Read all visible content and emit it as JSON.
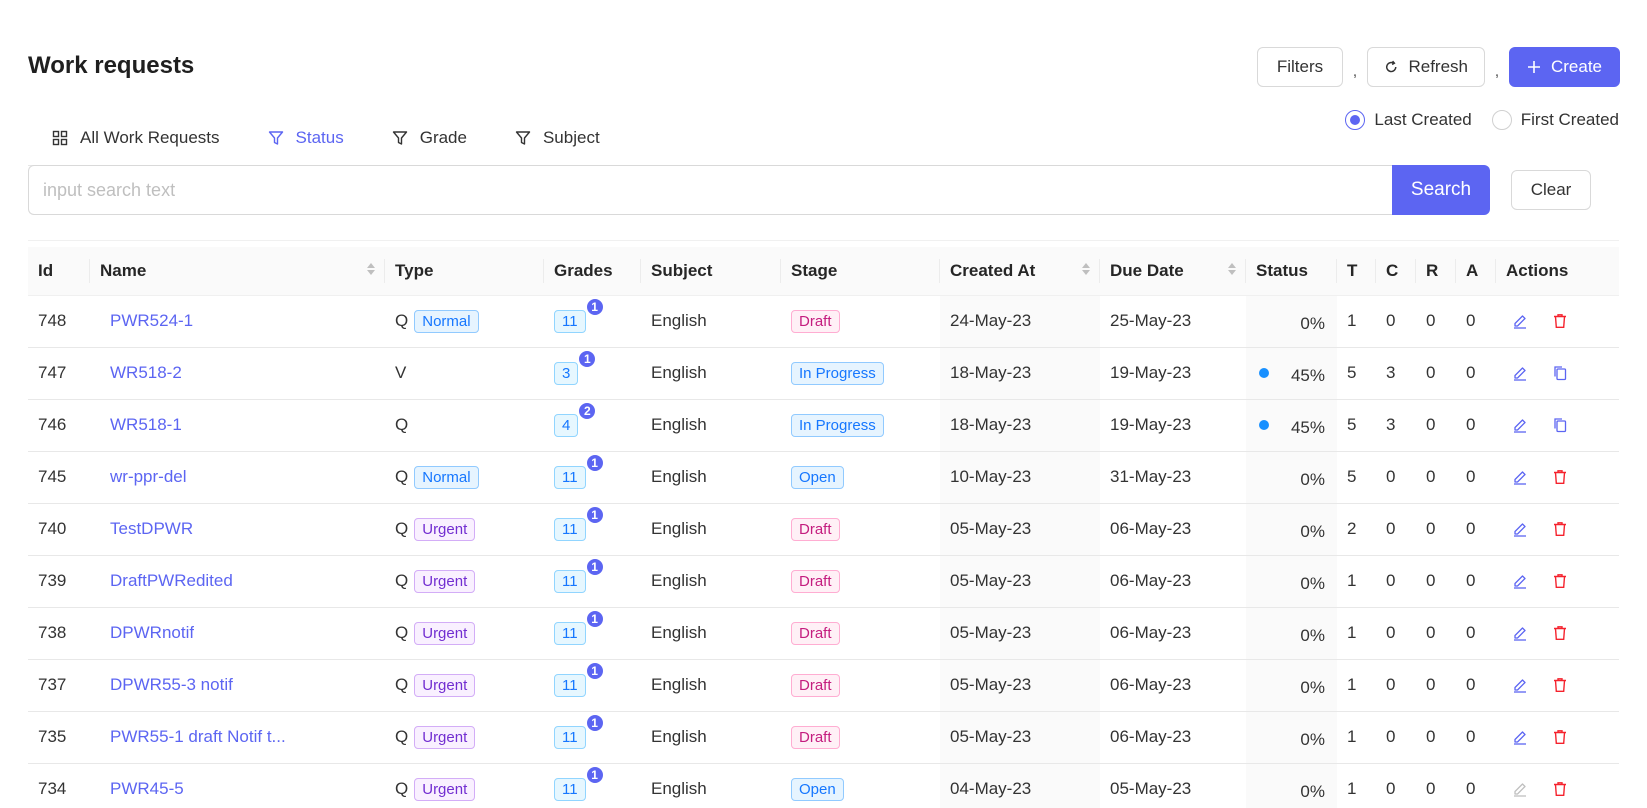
{
  "page": {
    "title": "Work requests"
  },
  "toolbar": {
    "filters_label": "Filters",
    "separator": ",",
    "refresh_label": "Refresh",
    "create_label": "Create"
  },
  "sort_options": [
    {
      "label": "Last Created",
      "selected": true
    },
    {
      "label": "First Created",
      "selected": false
    }
  ],
  "tabs": [
    {
      "label": "All Work Requests",
      "icon": "grid-icon",
      "active": false
    },
    {
      "label": "Status",
      "icon": "filter-icon",
      "active": true
    },
    {
      "label": "Grade",
      "icon": "filter-icon",
      "active": false
    },
    {
      "label": "Subject",
      "icon": "filter-icon",
      "active": false
    }
  ],
  "search": {
    "placeholder": "input search text",
    "value": "",
    "button_label": "Search",
    "clear_label": "Clear"
  },
  "table": {
    "columns": [
      "Id",
      "Name",
      "Type",
      "Grades",
      "Subject",
      "Stage",
      "Created At",
      "Due Date",
      "Status",
      "T",
      "C",
      "R",
      "A",
      "Actions"
    ],
    "rows": [
      {
        "id": "748",
        "name": "PWR524-1",
        "type": "Q",
        "priority": "Normal",
        "grade": "11",
        "grade_count": "1",
        "subject": "English",
        "stage": "Draft",
        "created": "24-May-23",
        "due": "25-May-23",
        "status": "0%",
        "status_dot": false,
        "t": "1",
        "c": "0",
        "r": "0",
        "a": "0",
        "second_action": "delete"
      },
      {
        "id": "747",
        "name": "WR518-2",
        "type": "V",
        "priority": "",
        "grade": "3",
        "grade_count": "1",
        "subject": "English",
        "stage": "In Progress",
        "created": "18-May-23",
        "due": "19-May-23",
        "status": "45%",
        "status_dot": true,
        "t": "5",
        "c": "3",
        "r": "0",
        "a": "0",
        "second_action": "copy"
      },
      {
        "id": "746",
        "name": "WR518-1",
        "type": "Q",
        "priority": "",
        "grade": "4",
        "grade_count": "2",
        "subject": "English",
        "stage": "In Progress",
        "created": "18-May-23",
        "due": "19-May-23",
        "status": "45%",
        "status_dot": true,
        "t": "5",
        "c": "3",
        "r": "0",
        "a": "0",
        "second_action": "copy"
      },
      {
        "id": "745",
        "name": "wr-ppr-del",
        "type": "Q",
        "priority": "Normal",
        "grade": "11",
        "grade_count": "1",
        "subject": "English",
        "stage": "Open",
        "created": "10-May-23",
        "due": "31-May-23",
        "status": "0%",
        "status_dot": false,
        "t": "5",
        "c": "0",
        "r": "0",
        "a": "0",
        "second_action": "delete"
      },
      {
        "id": "740",
        "name": "TestDPWR",
        "type": "Q",
        "priority": "Urgent",
        "grade": "11",
        "grade_count": "1",
        "subject": "English",
        "stage": "Draft",
        "created": "05-May-23",
        "due": "06-May-23",
        "status": "0%",
        "status_dot": false,
        "t": "2",
        "c": "0",
        "r": "0",
        "a": "0",
        "second_action": "delete"
      },
      {
        "id": "739",
        "name": "DraftPWRedited",
        "type": "Q",
        "priority": "Urgent",
        "grade": "11",
        "grade_count": "1",
        "subject": "English",
        "stage": "Draft",
        "created": "05-May-23",
        "due": "06-May-23",
        "status": "0%",
        "status_dot": false,
        "t": "1",
        "c": "0",
        "r": "0",
        "a": "0",
        "second_action": "delete"
      },
      {
        "id": "738",
        "name": "DPWRnotif",
        "type": "Q",
        "priority": "Urgent",
        "grade": "11",
        "grade_count": "1",
        "subject": "English",
        "stage": "Draft",
        "created": "05-May-23",
        "due": "06-May-23",
        "status": "0%",
        "status_dot": false,
        "t": "1",
        "c": "0",
        "r": "0",
        "a": "0",
        "second_action": "delete"
      },
      {
        "id": "737",
        "name": "DPWR55-3 notif",
        "type": "Q",
        "priority": "Urgent",
        "grade": "11",
        "grade_count": "1",
        "subject": "English",
        "stage": "Draft",
        "created": "05-May-23",
        "due": "06-May-23",
        "status": "0%",
        "status_dot": false,
        "t": "1",
        "c": "0",
        "r": "0",
        "a": "0",
        "second_action": "delete"
      },
      {
        "id": "735",
        "name": "PWR55-1 draft Notif t...",
        "type": "Q",
        "priority": "Urgent",
        "grade": "11",
        "grade_count": "1",
        "subject": "English",
        "stage": "Draft",
        "created": "05-May-23",
        "due": "06-May-23",
        "status": "0%",
        "status_dot": false,
        "t": "1",
        "c": "0",
        "r": "0",
        "a": "0",
        "second_action": "delete"
      },
      {
        "id": "734",
        "name": "PWR45-5",
        "type": "Q",
        "priority": "Urgent",
        "grade": "11",
        "grade_count": "1",
        "subject": "English",
        "stage": "Open",
        "created": "04-May-23",
        "due": "05-May-23",
        "status": "0%",
        "status_dot": false,
        "t": "1",
        "c": "0",
        "r": "0",
        "a": "0",
        "second_action": "delete",
        "edit_disabled": true
      }
    ]
  },
  "colors": {
    "primary": "#5c65f2",
    "delete": "#f5222d",
    "status_dot": "#1890ff"
  }
}
